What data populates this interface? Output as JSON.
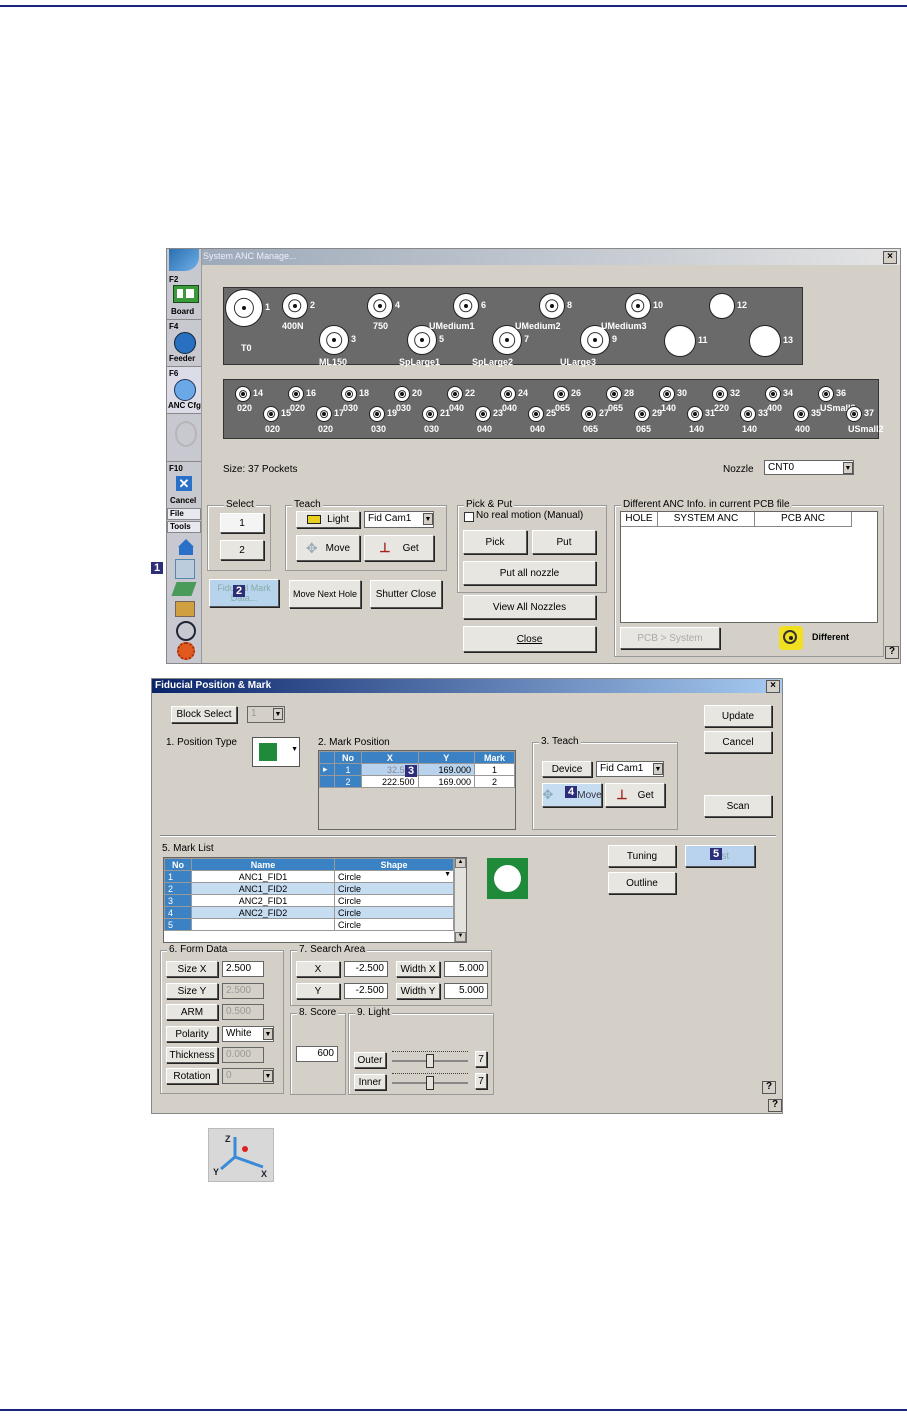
{
  "anc_manager": {
    "title": "System ANC Manage...",
    "sidebar": [
      {
        "key": "F2",
        "label": "Board"
      },
      {
        "key": "F4",
        "label": "Feeder"
      },
      {
        "key": "F6",
        "label": "ANC Cfg"
      },
      {
        "key": "F10",
        "label": "Cancel"
      },
      {
        "key": "",
        "label": "File"
      },
      {
        "key": "",
        "label": "Tools"
      }
    ],
    "rack_top": [
      {
        "num": "1",
        "name": "T0"
      },
      {
        "num": "2",
        "name": "400N"
      },
      {
        "num": "3",
        "name": "ML150"
      },
      {
        "num": "4",
        "name": "750"
      },
      {
        "num": "5",
        "name": "SpLarge1"
      },
      {
        "num": "6",
        "name": "UMedium1"
      },
      {
        "num": "7",
        "name": "SpLarge2"
      },
      {
        "num": "8",
        "name": "UMedium2"
      },
      {
        "num": "9",
        "name": "ULarge3"
      },
      {
        "num": "10",
        "name": "UMedium3"
      },
      {
        "num": "11",
        "name": ""
      },
      {
        "num": "12",
        "name": ""
      },
      {
        "num": "13",
        "name": ""
      }
    ],
    "rack_bottom_upper": [
      {
        "num": "14",
        "name": "020"
      },
      {
        "num": "16",
        "name": "020"
      },
      {
        "num": "18",
        "name": "030"
      },
      {
        "num": "20",
        "name": "030"
      },
      {
        "num": "22",
        "name": "040"
      },
      {
        "num": "24",
        "name": "040"
      },
      {
        "num": "26",
        "name": "065"
      },
      {
        "num": "28",
        "name": "065"
      },
      {
        "num": "30",
        "name": "140"
      },
      {
        "num": "32",
        "name": "220"
      },
      {
        "num": "34",
        "name": "400"
      },
      {
        "num": "36",
        "name": "USmall2"
      }
    ],
    "rack_bottom_lower": [
      {
        "num": "15",
        "name": "020"
      },
      {
        "num": "17",
        "name": "020"
      },
      {
        "num": "19",
        "name": "030"
      },
      {
        "num": "21",
        "name": "030"
      },
      {
        "num": "23",
        "name": "040"
      },
      {
        "num": "25",
        "name": "040"
      },
      {
        "num": "27",
        "name": "065"
      },
      {
        "num": "29",
        "name": "065"
      },
      {
        "num": "31",
        "name": "140"
      },
      {
        "num": "33",
        "name": "140"
      },
      {
        "num": "35",
        "name": "400"
      },
      {
        "num": "37",
        "name": "USmall2"
      }
    ],
    "size_text": "Size: 37 Pockets",
    "nozzle_label": "Nozzle",
    "nozzle_value": "CNT0",
    "select": {
      "title": "Select",
      "btn1": "1",
      "btn2": "2"
    },
    "teach": {
      "title": "Teach",
      "light": "Light",
      "camera": "Fid Cam1",
      "move": "Move",
      "get": "Get"
    },
    "fiducial_btn": "Fiducial Mark Data...",
    "move_next_hole": "Move Next Hole",
    "shutter_close": "Shutter Close",
    "pick_put": {
      "title": "Pick & Put",
      "checkbox": "No real motion (Manual)",
      "pick": "Pick",
      "put": "Put",
      "put_all": "Put all nozzle"
    },
    "view_all": "View All Nozzles",
    "close": "Close",
    "diff": {
      "title": "Different ANC Info. in current PCB file",
      "col1": "HOLE",
      "col2": "SYSTEM ANC",
      "col3": "PCB ANC",
      "pcb_system": "PCB > System",
      "different": "Different"
    },
    "help": "?"
  },
  "callouts": [
    "1",
    "2",
    "3",
    "4",
    "5"
  ],
  "fiducial": {
    "title": "Fiducial Position & Mark",
    "block_select": "Block Select",
    "block_value": "1",
    "update": "Update",
    "cancel": "Cancel",
    "scan": "Scan",
    "position_type": "1. Position Type",
    "mark_position": {
      "title": "2. Mark Position",
      "headers": [
        "No",
        "X",
        "Y",
        "Mark"
      ],
      "rows": [
        [
          "1",
          "32.500",
          "169.000",
          "1"
        ],
        [
          "2",
          "222.500",
          "169.000",
          "2"
        ]
      ]
    },
    "teach": {
      "title": "3. Teach",
      "device": "Device",
      "camera": "Fid Cam1",
      "move": "Move",
      "get": "Get"
    },
    "mark_list": {
      "title": "5. Mark List",
      "headers": [
        "No",
        "Name",
        "Shape"
      ],
      "rows": [
        [
          "1",
          "ANC1_FID1",
          "Circle"
        ],
        [
          "2",
          "ANC1_FID2",
          "Circle"
        ],
        [
          "3",
          "ANC2_FID1",
          "Circle"
        ],
        [
          "4",
          "ANC2_FID2",
          "Circle"
        ],
        [
          "5",
          "",
          "Circle"
        ]
      ]
    },
    "tuning": "Tuning",
    "outline": "Outline",
    "test": "Test",
    "form_data": {
      "title": "6. Form Data",
      "size_x_label": "Size X",
      "size_x": "2.500",
      "size_y_label": "Size Y",
      "size_y": "2.500",
      "arm_label": "ARM",
      "arm": "0.500",
      "polarity_label": "Polarity",
      "polarity": "White",
      "thickness_label": "Thickness",
      "thickness": "0.000",
      "rotation_label": "Rotation",
      "rotation": "0"
    },
    "search_area": {
      "title": "7. Search Area",
      "x_label": "X",
      "x": "-2.500",
      "width_x_label": "Width X",
      "width_x": "5.000",
      "y_label": "Y",
      "y": "-2.500",
      "width_y_label": "Width Y",
      "width_y": "5.000"
    },
    "score": {
      "title": "8. Score",
      "value": "600"
    },
    "light": {
      "title": "9. Light",
      "outer": "Outer",
      "outer_val": "7",
      "inner": "Inner",
      "inner_val": "7"
    },
    "help": "?"
  }
}
